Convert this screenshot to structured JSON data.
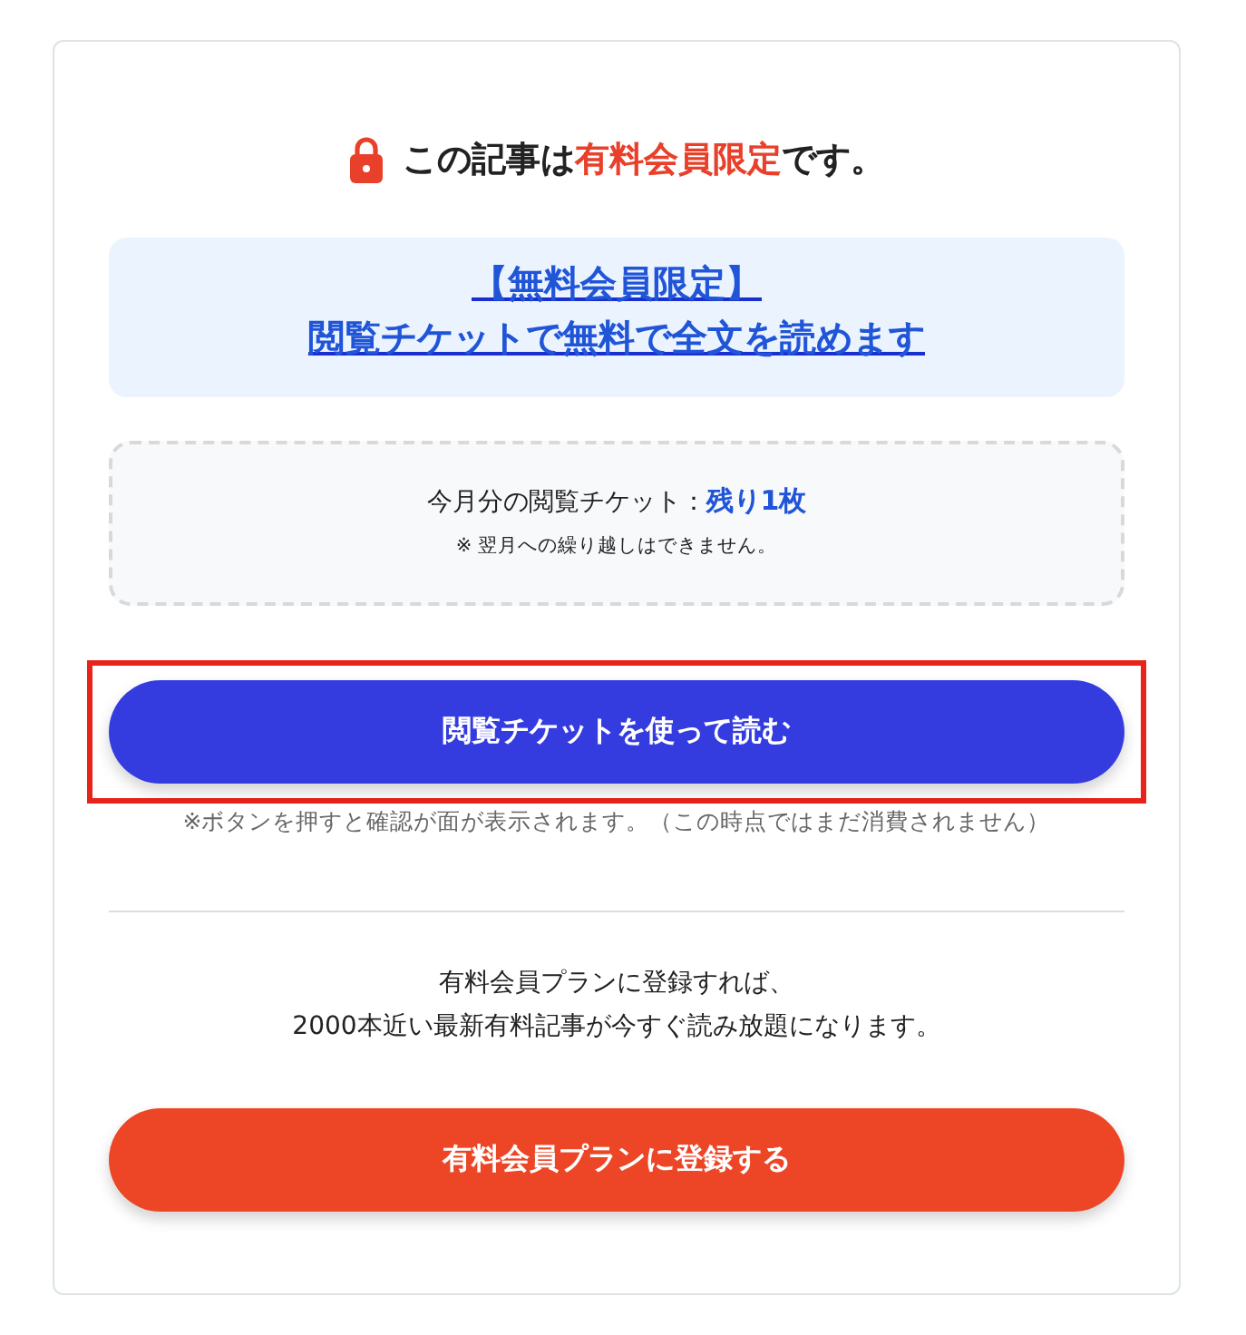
{
  "heading": {
    "before": "この記事は",
    "highlight": "有料会員限定",
    "after": "です。"
  },
  "free_link": {
    "lines": [
      "【無料会員限定】",
      "閲覧チケットで無料で全文を読めます"
    ]
  },
  "ticket": {
    "label": "今月分の閲覧チケット：",
    "remaining": "残り1枚",
    "note": "※ 翌月への繰り越しはできません。"
  },
  "use_ticket_button": {
    "label": "閲覧チケットを使って読む",
    "highlighted": true
  },
  "use_ticket_note": "※ボタンを押すと確認が面が表示されます。（この時点ではまだ消費されません）",
  "plan_text": [
    "有料会員プランに登録すれば、",
    "2000本近い最新有料記事が今すぐ読み放題になります。"
  ],
  "register_button": {
    "label": "有料会員プランに登録する"
  }
}
